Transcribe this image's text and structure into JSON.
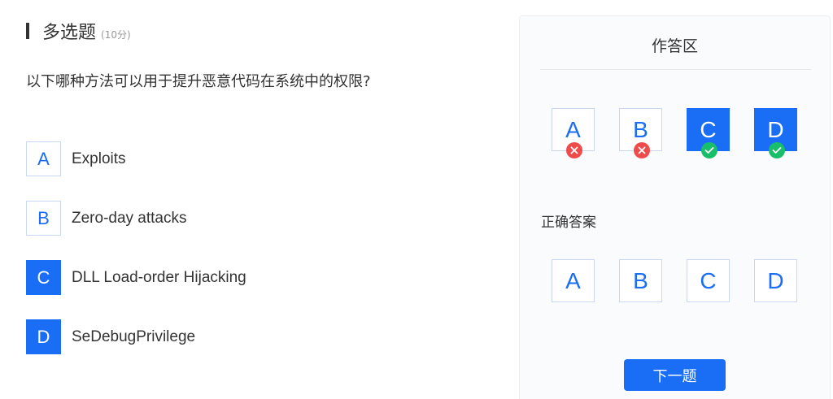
{
  "question": {
    "type_label": "多选题",
    "score": "(10分)",
    "text": "以下哪种方法可以用于提升恶意代码在系统中的权限?",
    "options": [
      {
        "letter": "A",
        "text": "Exploits",
        "selected": false
      },
      {
        "letter": "B",
        "text": "Zero-day attacks",
        "selected": false
      },
      {
        "letter": "C",
        "text": "DLL Load-order Hijacking",
        "selected": true
      },
      {
        "letter": "D",
        "text": "SeDebugPrivilege",
        "selected": true
      }
    ]
  },
  "panel": {
    "title": "作答区",
    "answers": [
      {
        "letter": "A",
        "selected": false,
        "status": "wrong",
        "status_icon": "x-icon"
      },
      {
        "letter": "B",
        "selected": false,
        "status": "wrong",
        "status_icon": "x-icon"
      },
      {
        "letter": "C",
        "selected": true,
        "status": "right",
        "status_icon": "check-icon"
      },
      {
        "letter": "D",
        "selected": true,
        "status": "right",
        "status_icon": "check-icon"
      }
    ],
    "correct_label": "正确答案",
    "correct_answers": [
      "A",
      "B",
      "C",
      "D"
    ],
    "next_button": "下一题"
  },
  "colors": {
    "accent": "#1a6ef5",
    "wrong": "#f04b4b",
    "right": "#19be6b"
  }
}
